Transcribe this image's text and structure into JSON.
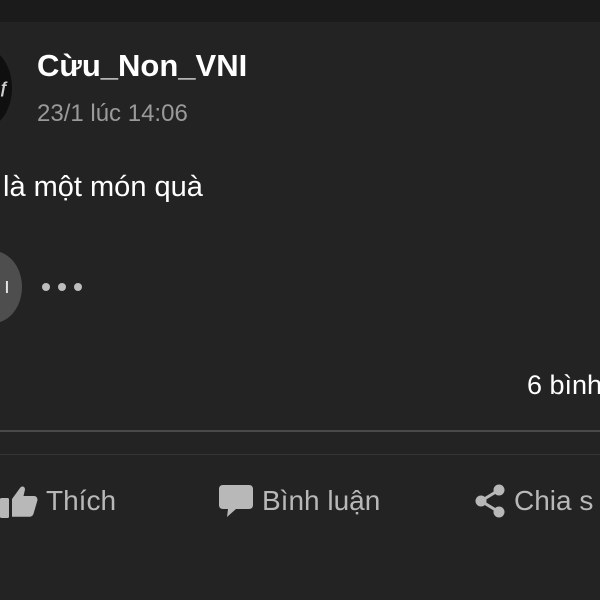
{
  "post": {
    "author": "Cừu_Non_VNI",
    "timestamp": "23/1 lúc 14:06",
    "text": "là một món quà",
    "comments_count": "6 bình"
  },
  "actions": {
    "like": "Thích",
    "comment": "Bình luận",
    "share": "Chia s"
  },
  "colors": {
    "background": "#232323",
    "secondary_text": "#9a9a9a",
    "action_text": "#b8b8b8"
  }
}
